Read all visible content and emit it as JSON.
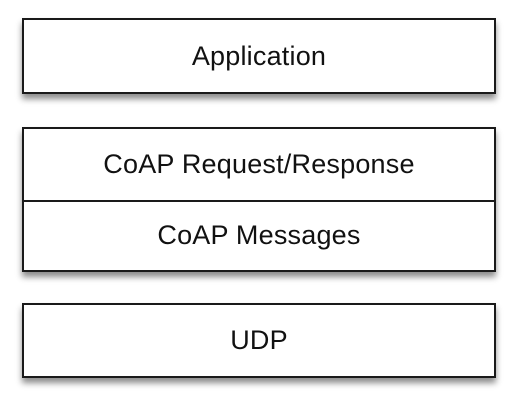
{
  "diagram": {
    "layers": {
      "application": "Application",
      "coap_request_response": "CoAP Request/Response",
      "coap_messages": "CoAP Messages",
      "udp": "UDP"
    }
  }
}
